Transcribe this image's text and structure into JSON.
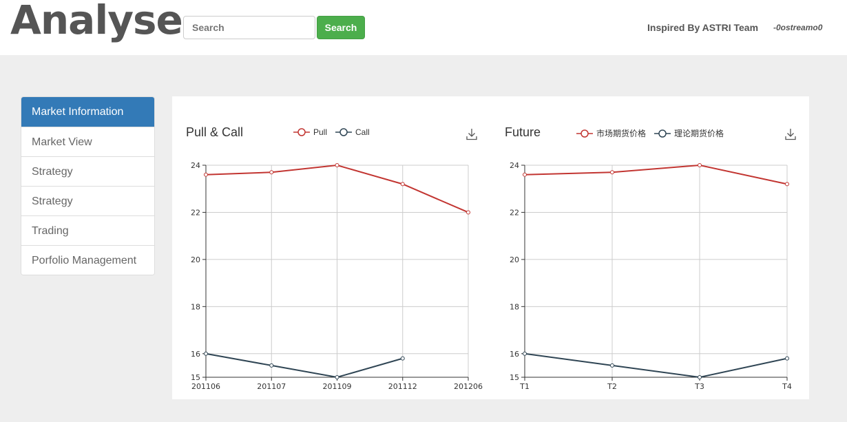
{
  "header": {
    "brand": "Analyse",
    "search_placeholder": "Search",
    "search_button": "Search",
    "credit": "Inspired By ASTRI Team",
    "username": "-0ostreamo0"
  },
  "sidebar": {
    "items": [
      {
        "label": "Market Information",
        "active": true
      },
      {
        "label": "Market View",
        "active": false
      },
      {
        "label": "Strategy",
        "active": false
      },
      {
        "label": "Strategy",
        "active": false
      },
      {
        "label": "Trading",
        "active": false
      },
      {
        "label": "Porfolio Management",
        "active": false
      }
    ]
  },
  "colors": {
    "series_red": "#c23531",
    "series_navy": "#2f4554",
    "active_nav": "#337ab7",
    "search_button": "#4cae4c"
  },
  "chart_data": [
    {
      "type": "line",
      "title": "Pull & Call",
      "categories": [
        "201106",
        "201107",
        "201109",
        "201112",
        "201206"
      ],
      "y_ticks": [
        15,
        16,
        18,
        20,
        22,
        24
      ],
      "ylim": [
        15,
        24
      ],
      "grid": true,
      "legend_position": "top-center",
      "download_icon": "download-icon",
      "series": [
        {
          "name": "Pull",
          "color": "#c23531",
          "values": [
            23.6,
            23.7,
            24,
            23.2,
            22
          ]
        },
        {
          "name": "Call",
          "color": "#2f4554",
          "values": [
            16,
            15.5,
            15,
            15.8,
            null
          ]
        }
      ]
    },
    {
      "type": "line",
      "title": "Future",
      "categories": [
        "T1",
        "T2",
        "T3",
        "T4"
      ],
      "y_ticks": [
        15,
        16,
        18,
        20,
        22,
        24
      ],
      "ylim": [
        15,
        24
      ],
      "grid": true,
      "legend_position": "top-center",
      "download_icon": "download-icon",
      "series": [
        {
          "name": "市场期货价格",
          "color": "#c23531",
          "values": [
            23.6,
            23.7,
            24,
            23.2
          ]
        },
        {
          "name": "理论期货价格",
          "color": "#2f4554",
          "values": [
            16,
            15.5,
            15,
            15.8
          ]
        }
      ]
    }
  ]
}
